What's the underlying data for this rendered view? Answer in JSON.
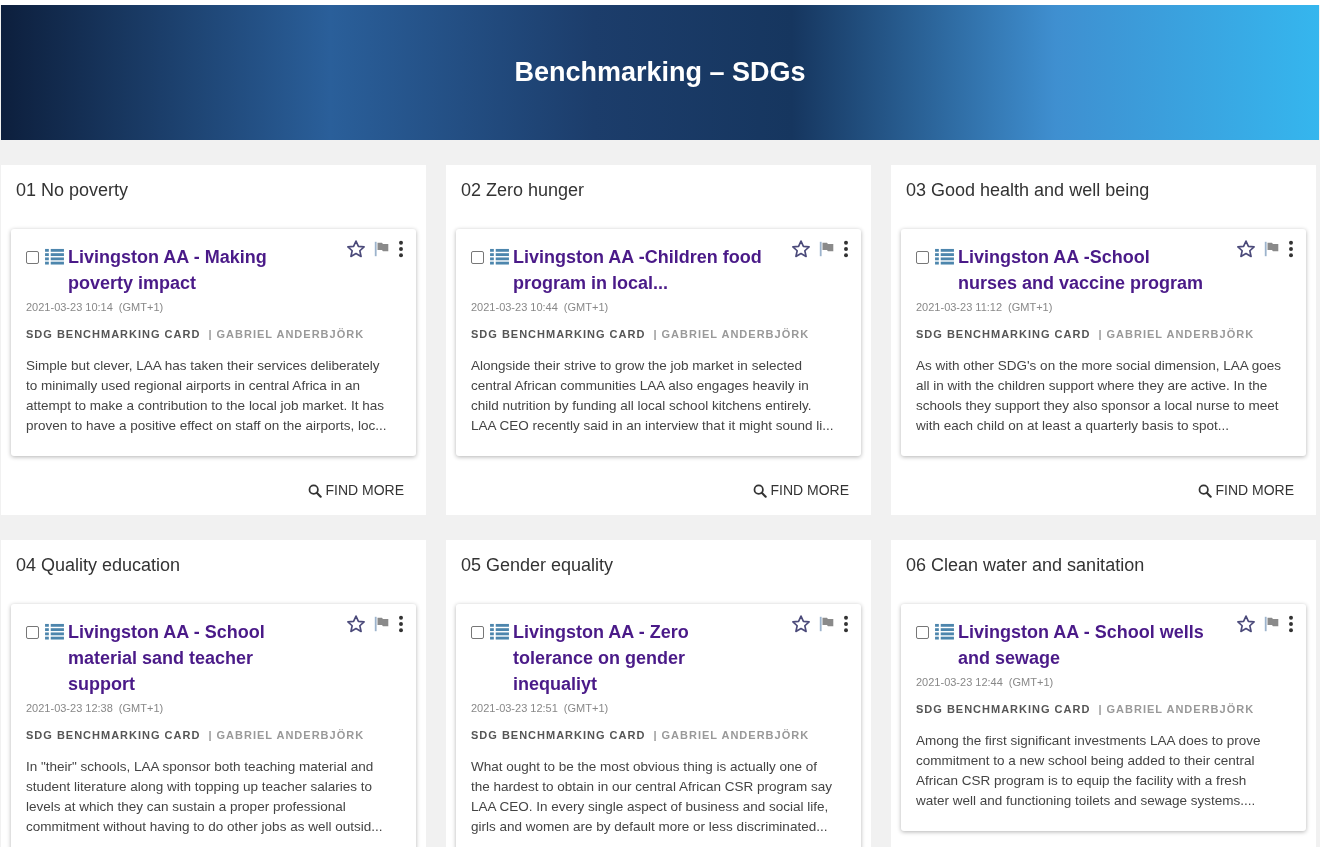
{
  "header": {
    "title": "Benchmarking – SDGs"
  },
  "panels": [
    {
      "heading": "01 No poverty",
      "find_more": "FIND MORE",
      "cards": [
        {
          "checked": false,
          "starred": false,
          "title": "Livingston AA - Making poverty impact",
          "date": "2021-03-23 10:14",
          "timezone": "(GMT+1)",
          "type": "SDG BENCHMARKING CARD",
          "author": "| GABRIEL ANDERBJÖRK",
          "excerpt": "Simple but clever, LAA has taken their services deliberately to minimally used regional airports in central Africa in an attempt to make a contribution to the local job market. It has proven to have a positive effect on staff on the airports, loc..."
        }
      ]
    },
    {
      "heading": "02 Zero hunger",
      "find_more": "FIND MORE",
      "cards": [
        {
          "checked": false,
          "starred": false,
          "title": "Livingston AA -Children food program in local...",
          "date": "2021-03-23 10:44",
          "timezone": "(GMT+1)",
          "type": "SDG BENCHMARKING CARD",
          "author": "| GABRIEL ANDERBJÖRK",
          "excerpt": "Alongside their strive to grow the job market in selected central African communities LAA also engages heavily in child nutrition by funding all local school kitchens entirely. LAA CEO recently said in an interview that it might sound li..."
        }
      ]
    },
    {
      "heading": "03 Good health and well being",
      "find_more": "FIND MORE",
      "cards": [
        {
          "checked": false,
          "starred": false,
          "title": "Livingston AA -School nurses and vaccine program",
          "date": "2021-03-23 11:12",
          "timezone": "(GMT+1)",
          "type": "SDG BENCHMARKING CARD",
          "author": "| GABRIEL ANDERBJÖRK",
          "excerpt": "As with other SDG's on the more social dimension, LAA goes all in with the children support where they are active. In the schools they support they also sponsor a local nurse to meet with each child on at least a quarterly basis to spot..."
        }
      ]
    },
    {
      "heading": "04 Quality education",
      "cards": [
        {
          "checked": false,
          "starred": false,
          "title": "Livingston AA - School material sand teacher support",
          "date": "2021-03-23 12:38",
          "timezone": "(GMT+1)",
          "type": "SDG BENCHMARKING CARD",
          "author": "| GABRIEL ANDERBJÖRK",
          "excerpt": "In \"their\" schools, LAA sponsor both teaching material and student literature along with topping up teacher salaries to levels at which they can sustain a proper professional commitment without having to do other jobs as well outsid..."
        }
      ]
    },
    {
      "heading": "05 Gender equality",
      "cards": [
        {
          "checked": false,
          "starred": false,
          "title": "Livingston AA - Zero tolerance on gender inequaliyt",
          "date": "2021-03-23 12:51",
          "timezone": "(GMT+1)",
          "type": "SDG BENCHMARKING CARD",
          "author": "| GABRIEL ANDERBJÖRK",
          "excerpt": "What ought to be the most obvious thing is actually one of the hardest to obtain in our central African CSR program say LAA CEO. In every single aspect of business and social life, girls and women are by default more or less discriminated..."
        }
      ]
    },
    {
      "heading": "06 Clean water and sanitation",
      "cards": [
        {
          "checked": false,
          "starred": false,
          "title": "Livingston AA - School wells and sewage",
          "date": "2021-03-23 12:44",
          "timezone": "(GMT+1)",
          "type": "SDG BENCHMARKING CARD",
          "author": "| GABRIEL ANDERBJÖRK",
          "excerpt": "Among the first significant investments LAA does to prove commitment to a new school being added to their central African CSR program is to equip the facility with a fresh water well and functioning toilets and sewage systems...."
        }
      ]
    }
  ]
}
